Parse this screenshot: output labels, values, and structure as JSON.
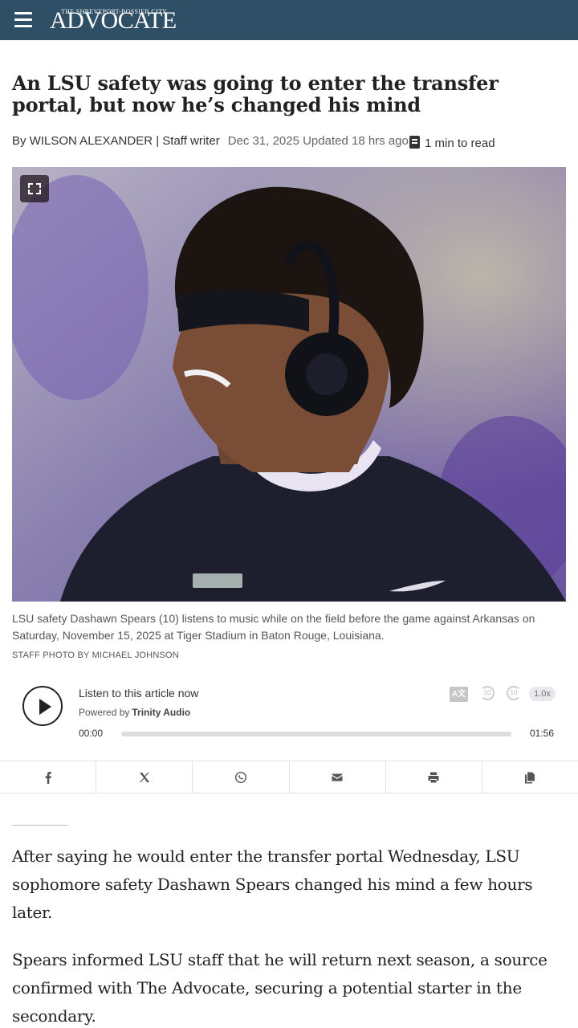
{
  "header": {
    "menu_icon": "hamburger-menu-icon",
    "logo_small": "THE SHREVEPORT-BOSSIER CITY",
    "logo_big": "ADVOCATE",
    "brand_color": "#2f4f66"
  },
  "article": {
    "headline": "An LSU safety was going to enter the transfer portal, but now he’s changed his mind",
    "byline_author": "By WILSON ALEXANDER | Staff writer",
    "byline_date": "Dec 31, 2025 Updated 18 hrs ago",
    "read_time": "1 min to read",
    "photo_caption": "LSU safety Dashawn Spears (10) listens to music while on the field before the game against Arkansas on Saturday, November 15, 2025 at Tiger Stadium in Baton Rouge, Louisiana.",
    "photo_credit": "STAFF PHOTO BY MICHAEL JOHNSON",
    "paragraphs": [
      "After saying he would enter the transfer portal Wednesday, LSU sophomore safety Dashawn Spears changed his mind a few hours later.",
      "Spears informed LSU staff that he will return next season, a source confirmed with The Advocate, securing a potential starter in the secondary."
    ]
  },
  "audio": {
    "title": "Listen to this article now",
    "powered_by": "Powered by",
    "provider": "Trinity Audio",
    "time_current": "00:00",
    "time_total": "01:56",
    "translate_label": "A文",
    "rewind_label": "10",
    "forward_label": "10",
    "speed": "1.0x",
    "progress": 0
  },
  "share": [
    "facebook-icon",
    "x-icon",
    "whatsapp-icon",
    "email-icon",
    "print-icon",
    "copy-icon"
  ]
}
